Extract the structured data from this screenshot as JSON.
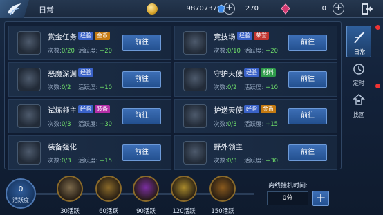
{
  "title": "日常",
  "resources": {
    "gold": {
      "value": "9870737",
      "icon": "gold-coin-icon"
    },
    "gem": {
      "value": "270",
      "icon": "blue-gem-icon"
    },
    "ruby": {
      "value": "0",
      "icon": "pink-crystal-icon"
    }
  },
  "colors": {
    "exp_tag": "#3a62c8",
    "gold_tag": "#c47a12",
    "equip_tag": "#b52fa8",
    "material_tag": "#2e9a4a",
    "prestige_tag": "#c0342f"
  },
  "tasks": [
    {
      "name": "赏金任务",
      "tags": [
        {
          "text": "经验",
          "kind": "exp"
        },
        {
          "text": "金币",
          "kind": "gold"
        }
      ],
      "count_label": "次数:",
      "count": "0/20",
      "activity_label": "活跃度:",
      "activity": "+20",
      "button": "前往",
      "icon": "bounty-chest-icon"
    },
    {
      "name": "竞技场",
      "tags": [
        {
          "text": "经验",
          "kind": "exp"
        },
        {
          "text": "荣誉",
          "kind": "prestige"
        }
      ],
      "count_label": "次数:",
      "count": "0/10",
      "activity_label": "活跃度:",
      "activity": "+20",
      "button": "前往",
      "icon": "arena-helmet-icon"
    },
    {
      "name": "恶魔深渊",
      "tags": [
        {
          "text": "经验",
          "kind": "exp"
        }
      ],
      "count_label": "次数:",
      "count": "0/2",
      "activity_label": "活跃度:",
      "activity": "+10",
      "button": "前往",
      "icon": "demon-abyss-icon"
    },
    {
      "name": "守护天使",
      "tags": [
        {
          "text": "经验",
          "kind": "exp"
        },
        {
          "text": "材料",
          "kind": "material"
        }
      ],
      "count_label": "次数:",
      "count": "0/2",
      "activity_label": "活跃度:",
      "activity": "+10",
      "button": "前往",
      "icon": "angel-sword-icon"
    },
    {
      "name": "试炼领主",
      "tags": [
        {
          "text": "经验",
          "kind": "exp"
        },
        {
          "text": "装备",
          "kind": "equip"
        }
      ],
      "count_label": "次数:",
      "count": "0/3",
      "activity_label": "活跃度:",
      "activity": "+30",
      "button": "前往",
      "icon": "trial-lord-shield-icon"
    },
    {
      "name": "护送天使",
      "tags": [
        {
          "text": "经验",
          "kind": "exp"
        },
        {
          "text": "金币",
          "kind": "gold"
        }
      ],
      "count_label": "次数:",
      "count": "0/3",
      "activity_label": "活跃度:",
      "activity": "+15",
      "button": "前往",
      "icon": "escort-angel-icon"
    },
    {
      "name": "装备强化",
      "tags": [],
      "count_label": "次数:",
      "count": "0/3",
      "activity_label": "活跃度:",
      "activity": "+15",
      "button": "前往",
      "icon": "forge-hammer-icon"
    },
    {
      "name": "野外领主",
      "tags": [],
      "count_label": "次数:",
      "count": "0/3",
      "activity_label": "活跃度:",
      "activity": "+30",
      "button": "前往",
      "icon": "field-lord-beast-icon"
    }
  ],
  "tabs": [
    {
      "label": "日常",
      "icon": "daily-quill-icon",
      "active": true,
      "alert": true
    },
    {
      "label": "定时",
      "icon": "timer-icon",
      "active": false,
      "alert": true
    },
    {
      "label": "找回",
      "icon": "recover-icon",
      "active": false,
      "alert": false
    }
  ],
  "activity": {
    "value": "0",
    "label": "活跃度",
    "progress": 0
  },
  "rewards": [
    {
      "label": "30活跃",
      "icon": "armor-reward-icon"
    },
    {
      "label": "60活跃",
      "icon": "coin-pouch-reward-icon"
    },
    {
      "label": "90活跃",
      "icon": "purple-orb-reward-icon"
    },
    {
      "label": "120活跃",
      "icon": "gold-coin-reward-icon"
    },
    {
      "label": "150活跃",
      "icon": "treasure-chest-reward-icon"
    }
  ],
  "offline": {
    "label": "离线挂机时间:",
    "value": "0分",
    "add": "+"
  }
}
